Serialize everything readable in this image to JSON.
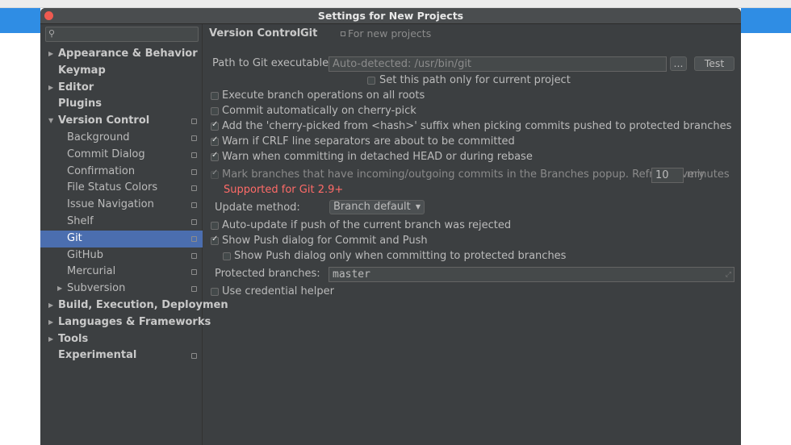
{
  "dialog": {
    "title": "Settings for New Projects"
  },
  "search": {
    "placeholder": ""
  },
  "sidebar": {
    "items": [
      {
        "label": "Appearance & Behavior",
        "level": 0,
        "arrow": "▶",
        "bold": true,
        "project": false,
        "selected": false
      },
      {
        "label": "Keymap",
        "level": 0,
        "arrow": "",
        "bold": true,
        "project": false,
        "selected": false
      },
      {
        "label": "Editor",
        "level": 0,
        "arrow": "▶",
        "bold": true,
        "project": false,
        "selected": false
      },
      {
        "label": "Plugins",
        "level": 0,
        "arrow": "",
        "bold": true,
        "project": false,
        "selected": false
      },
      {
        "label": "Version Control",
        "level": 0,
        "arrow": "▼",
        "bold": true,
        "project": true,
        "selected": false
      },
      {
        "label": "Background",
        "level": 1,
        "arrow": "",
        "bold": false,
        "project": true,
        "selected": false
      },
      {
        "label": "Commit Dialog",
        "level": 1,
        "arrow": "",
        "bold": false,
        "project": true,
        "selected": false
      },
      {
        "label": "Confirmation",
        "level": 1,
        "arrow": "",
        "bold": false,
        "project": true,
        "selected": false
      },
      {
        "label": "File Status Colors",
        "level": 1,
        "arrow": "",
        "bold": false,
        "project": true,
        "selected": false
      },
      {
        "label": "Issue Navigation",
        "level": 1,
        "arrow": "",
        "bold": false,
        "project": true,
        "selected": false
      },
      {
        "label": "Shelf",
        "level": 1,
        "arrow": "",
        "bold": false,
        "project": true,
        "selected": false
      },
      {
        "label": "Git",
        "level": 1,
        "arrow": "",
        "bold": false,
        "project": true,
        "selected": true
      },
      {
        "label": "GitHub",
        "level": 1,
        "arrow": "",
        "bold": false,
        "project": true,
        "selected": false
      },
      {
        "label": "Mercurial",
        "level": 1,
        "arrow": "",
        "bold": false,
        "project": true,
        "selected": false
      },
      {
        "label": "Subversion",
        "level": 1,
        "arrow": "▶",
        "bold": false,
        "project": true,
        "selected": false
      },
      {
        "label": "Build, Execution, Deploymen",
        "level": 0,
        "arrow": "▶",
        "bold": true,
        "project": false,
        "selected": false
      },
      {
        "label": "Languages & Frameworks",
        "level": 0,
        "arrow": "▶",
        "bold": true,
        "project": false,
        "selected": false
      },
      {
        "label": "Tools",
        "level": 0,
        "arrow": "▶",
        "bold": true,
        "project": false,
        "selected": false
      },
      {
        "label": "Experimental",
        "level": 0,
        "arrow": "",
        "bold": true,
        "project": true,
        "selected": false
      }
    ]
  },
  "breadcrumb": {
    "parent": "Version Control",
    "separator": "›",
    "current": "Git",
    "scope": "For new projects"
  },
  "git": {
    "path_label": "Path to Git executable:",
    "path_value": "Auto-detected: /usr/bin/git",
    "browse_label": "...",
    "test_label": "Test",
    "path_current_project": {
      "label": "Set this path only for current project",
      "checked": false
    },
    "options": [
      {
        "label": "Execute branch operations on all roots",
        "checked": false
      },
      {
        "label": "Commit automatically on cherry-pick",
        "checked": false
      },
      {
        "label": "Add the 'cherry-picked from <hash>' suffix when picking commits pushed to protected branches",
        "checked": true
      },
      {
        "label": "Warn if CRLF line separators are about to be committed",
        "checked": true
      },
      {
        "label": "Warn when committing in detached HEAD or during rebase",
        "checked": true
      }
    ],
    "mark_branches": {
      "label": "Mark branches that have incoming/outgoing commits in the Branches popup.  Refresh every",
      "checked": true,
      "disabled": true,
      "interval": "10",
      "unit": "minutes",
      "warning": "Supported for Git 2.9+"
    },
    "update_method": {
      "label": "Update method:",
      "value": "Branch default"
    },
    "auto_update": {
      "label": "Auto-update if push of the current branch was rejected",
      "checked": false
    },
    "show_push": {
      "label": "Show Push dialog for Commit and Push",
      "checked": true
    },
    "show_push_protected": {
      "label": "Show Push dialog only when committing to protected branches",
      "checked": false
    },
    "protected_branches": {
      "label": "Protected branches:",
      "value": "master"
    },
    "credential_helper": {
      "label": "Use credential helper",
      "checked": false
    }
  },
  "colors": {
    "selection": "#4b6eaf",
    "warning": "#ff6b68",
    "panel": "#3c3f41",
    "accent_blue": "#2f8de4"
  }
}
